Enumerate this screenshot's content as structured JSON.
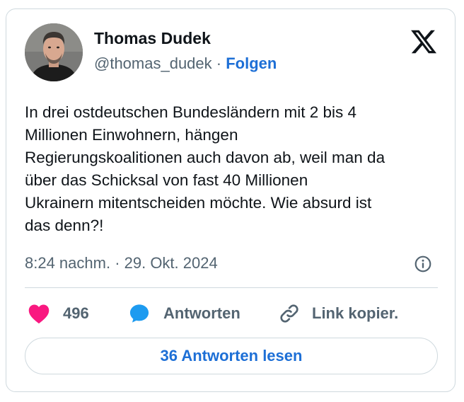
{
  "author": {
    "display_name": "Thomas Dudek",
    "handle": "@thomas_dudek",
    "separator": "·",
    "follow_label": "Folgen"
  },
  "platform_icon": "x-logo-icon",
  "tweet": {
    "lines": [
      "In drei ostdeutschen Bundesländern mit 2 bis 4",
      "Millionen Einwohnern, hängen",
      "Regierungskoalitionen auch davon ab, weil man da",
      "über das Schicksal von fast 40 Millionen",
      "Ukrainern mitentscheiden möchte. Wie absurd ist",
      "das denn?!"
    ],
    "timestamp": "8:24 nachm. · 29. Okt. 2024",
    "info_icon": "info-icon"
  },
  "actions": {
    "like_icon": "heart-icon",
    "like_count": "496",
    "reply_icon": "speech-bubble-icon",
    "reply_label": "Antworten",
    "copy_icon": "link-icon",
    "copy_label": "Link kopier."
  },
  "read_replies_label": "36 Antworten lesen",
  "colors": {
    "accent": "#1d6fd6",
    "heart": "#f91880",
    "muted_text": "#536471",
    "border": "#cfd9de"
  }
}
